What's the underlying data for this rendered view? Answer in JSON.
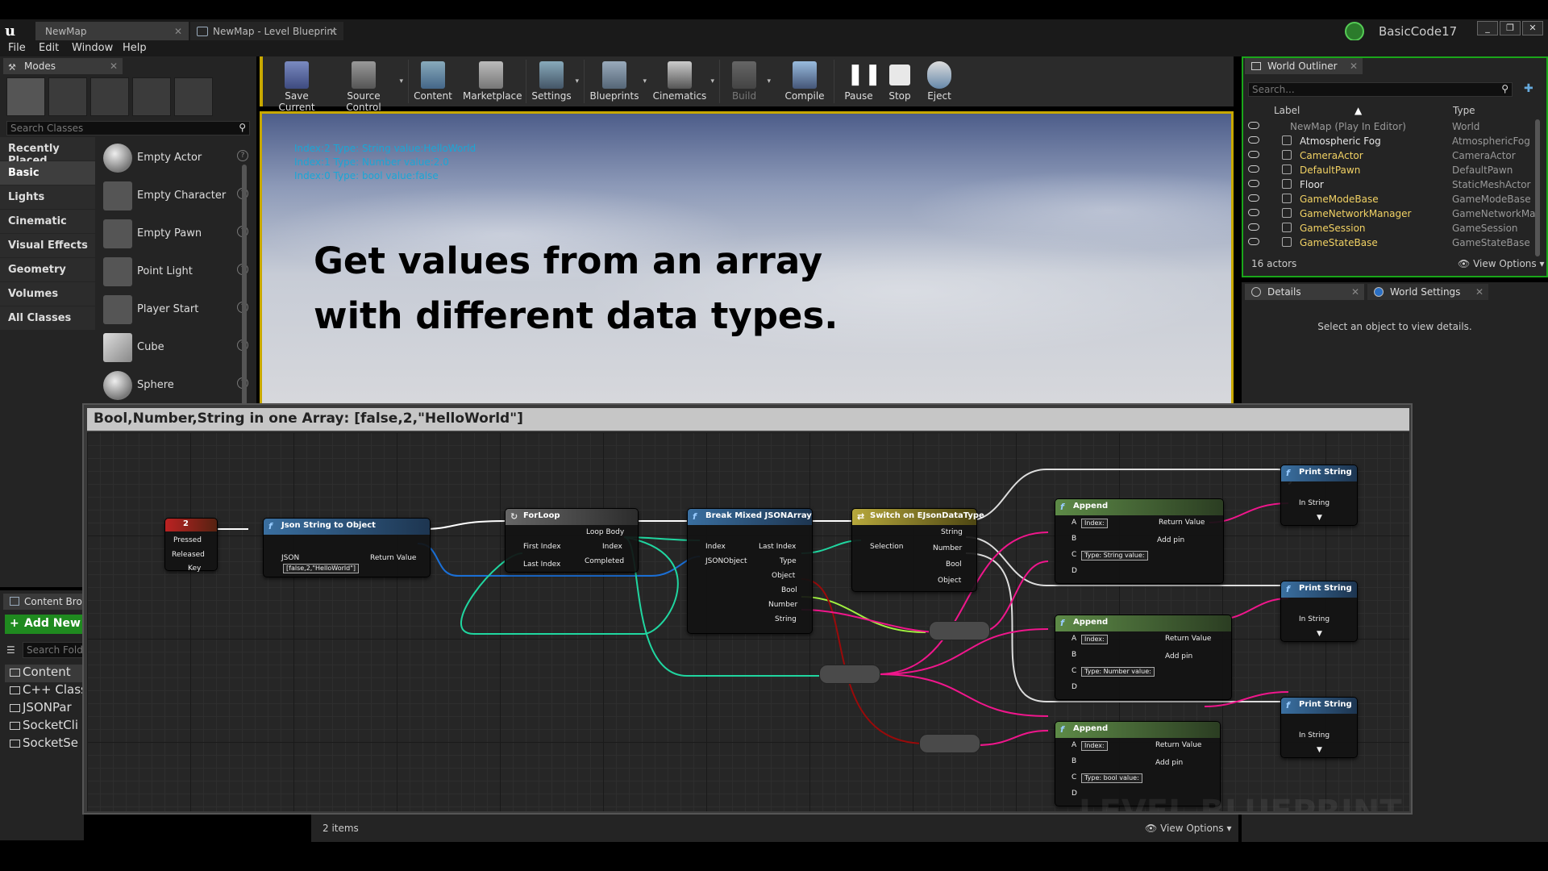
{
  "titlebar": {
    "logo": "u",
    "tabs": [
      {
        "label": "NewMap"
      },
      {
        "label": "NewMap - Level Blueprint"
      }
    ],
    "user": "BasicCode17",
    "window_controls": [
      "_",
      "❐",
      "✕"
    ]
  },
  "menu": [
    "File",
    "Edit",
    "Window",
    "Help"
  ],
  "modes": {
    "tab_label": "Modes",
    "search_placeholder": "Search Classes",
    "categories": [
      "Recently Placed",
      "Basic",
      "Lights",
      "Cinematic",
      "Visual Effects",
      "Geometry",
      "Volumes",
      "All Classes"
    ],
    "active_category": "Basic",
    "items": [
      {
        "label": "Empty Actor"
      },
      {
        "label": "Empty Character"
      },
      {
        "label": "Empty Pawn"
      },
      {
        "label": "Point Light"
      },
      {
        "label": "Player Start"
      },
      {
        "label": "Cube"
      },
      {
        "label": "Sphere"
      }
    ]
  },
  "content_browser": {
    "tab_label": "Content Brov",
    "add_new_label": "Add New",
    "search_placeholder": "Search Folde",
    "folders": [
      "Content",
      "C++ Class",
      "JSONPar",
      "SocketCli",
      "SocketSe"
    ]
  },
  "toolbar": {
    "buttons": [
      {
        "label": "Save Current"
      },
      {
        "label": "Source Control"
      },
      {
        "label": "Content"
      },
      {
        "label": "Marketplace"
      },
      {
        "label": "Settings"
      },
      {
        "label": "Blueprints"
      },
      {
        "label": "Cinematics"
      },
      {
        "label": "Build"
      },
      {
        "label": "Compile"
      },
      {
        "label": "Pause"
      },
      {
        "label": "Stop"
      },
      {
        "label": "Eject"
      }
    ]
  },
  "viewport": {
    "log_lines": [
      "Index:2 Type: String value:HelloWorld",
      "Index:1 Type: Number  value:2.0",
      "Index:0 Type: bool value:false"
    ],
    "headline": [
      "Get values from an array",
      "with different data types."
    ]
  },
  "outliner": {
    "tab_label": "World Outliner",
    "search_placeholder": "Search...",
    "col_label": "Label",
    "col_type": "Type",
    "rows": [
      {
        "name": "NewMap (Play In Editor)",
        "type": "World"
      },
      {
        "name": "Atmospheric Fog",
        "type": "AtmosphericFog"
      },
      {
        "name": "CameraActor",
        "type": "CameraActor"
      },
      {
        "name": "DefaultPawn",
        "type": "DefaultPawn"
      },
      {
        "name": "Floor",
        "type": "StaticMeshActor"
      },
      {
        "name": "GameModeBase",
        "type": "GameModeBase"
      },
      {
        "name": "GameNetworkManager",
        "type": "GameNetworkMar"
      },
      {
        "name": "GameSession",
        "type": "GameSession"
      },
      {
        "name": "GameStateBase",
        "type": "GameStateBase"
      }
    ],
    "count": "16 actors",
    "view_options": "View Options"
  },
  "details": {
    "tab_label": "Details",
    "world_settings_label": "World Settings",
    "empty_message": "Select an object to view details."
  },
  "blueprint": {
    "title": "Bool,Number,String in one Array: [false,2,\"HelloWorld\"]",
    "watermark": "LEVEL BLUEPRINT",
    "nodes": {
      "key_event": {
        "title": "2",
        "pins": [
          "Pressed",
          "Released",
          "Key"
        ]
      },
      "json_to_object": {
        "title": "Json String to Object",
        "pin_json": "JSON",
        "json_value": "[false,2,\"HelloWorld\"]",
        "pin_return": "Return Value"
      },
      "for_loop": {
        "title": "ForLoop",
        "pins_in": [
          "First Index",
          "Last Index"
        ],
        "pins_out": [
          "Loop Body",
          "Index",
          "Completed"
        ]
      },
      "break_array": {
        "title": "Break Mixed JSONArray",
        "pins_in": [
          "Index",
          "JSONObject"
        ],
        "pins_out": [
          "Last Index",
          "Type",
          "Object",
          "Bool",
          "Number",
          "String"
        ]
      },
      "switch": {
        "title": "Switch on EJsonDataType",
        "pin_in": "Selection",
        "pins_out": [
          "String",
          "Number",
          "Bool",
          "Object"
        ]
      },
      "append1": {
        "title": "Append",
        "pins": [
          "A",
          "B",
          "C",
          "D"
        ],
        "a_value": "Index:",
        "c_value": "Type: String value:",
        "return": "Return Value",
        "add_pin": "Add pin"
      },
      "append2": {
        "title": "Append",
        "pins": [
          "A",
          "B",
          "C",
          "D"
        ],
        "a_value": "Index:",
        "c_value": "Type: Number value:",
        "return": "Return Value",
        "add_pin": "Add pin"
      },
      "append3": {
        "title": "Append",
        "pins": [
          "A",
          "B",
          "C",
          "D"
        ],
        "a_value": "Index:",
        "c_value": "Type: bool value:",
        "return": "Return Value",
        "add_pin": "Add pin"
      },
      "print1": {
        "title": "Print String",
        "pin": "In String"
      },
      "print2": {
        "title": "Print String",
        "pin": "In String"
      },
      "print3": {
        "title": "Print String",
        "pin": "In String"
      }
    }
  },
  "status": {
    "items": "2 items",
    "view_options": "View Options"
  },
  "colors": {
    "exec": "#ffffff",
    "object": "#1a6fd6",
    "int": "#20d6a0",
    "string": "#f0168c",
    "bool": "#9a0a0a",
    "float": "#a0f040",
    "accent_yellow": "#c8a800",
    "outliner_green": "#1aa61a"
  }
}
